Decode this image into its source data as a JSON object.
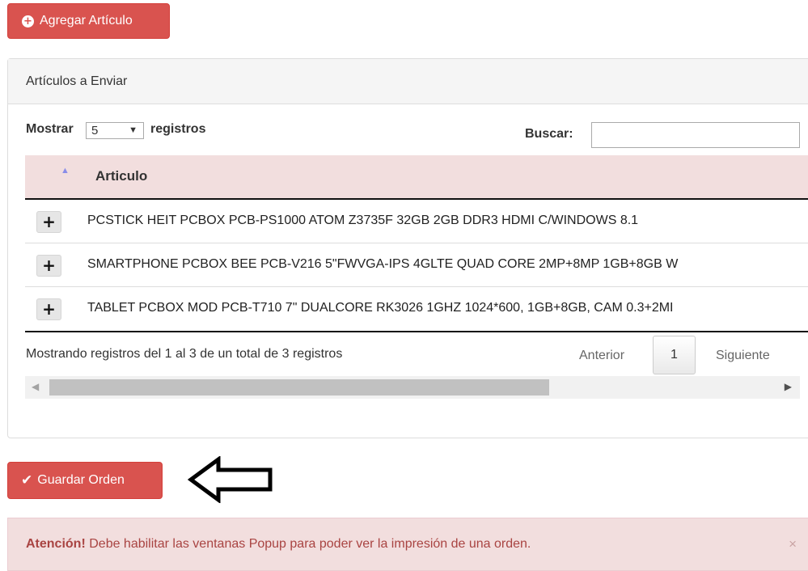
{
  "buttons": {
    "add_label": "Agregar Artículo",
    "save_label": "Guardar Orden"
  },
  "panel": {
    "title": "Artículos a Enviar"
  },
  "table_controls": {
    "show_label": "Mostrar",
    "page_length": "5",
    "records_label": "registros",
    "search_label": "Buscar:",
    "search_value": ""
  },
  "table": {
    "column_header": "Articulo",
    "rows": [
      "PCSTICK HEIT PCBOX PCB-PS1000 ATOM Z3735F 32GB 2GB DDR3 HDMI C/WINDOWS 8.1",
      "SMARTPHONE PCBOX BEE PCB-V216 5\"FWVGA-IPS 4GLTE QUAD CORE 2MP+8MP 1GB+8GB W",
      "TABLET PCBOX MOD PCB-T710 7\" DUALCORE RK3026 1GHZ 1024*600, 1GB+8GB, CAM 0.3+2MI"
    ],
    "expand_glyph": "+"
  },
  "footer": {
    "info": "Mostrando registros del 1 al 3 de un total de 3 registros",
    "prev": "Anterior",
    "current_page": "1",
    "next": "Siguiente"
  },
  "alert": {
    "strong": "Atención!",
    "message": "Debe habilitar las ventanas Popup para poder ver la impresión de una orden.",
    "close": "×"
  },
  "icons": [
    "plus-circle-icon",
    "check-icon",
    "sort-asc-icon",
    "plus-icon",
    "arrow-left-icon",
    "close-icon"
  ],
  "colors": {
    "danger": "#d9534f",
    "header_bg": "#f2dede",
    "alert_text": "#a94442"
  }
}
